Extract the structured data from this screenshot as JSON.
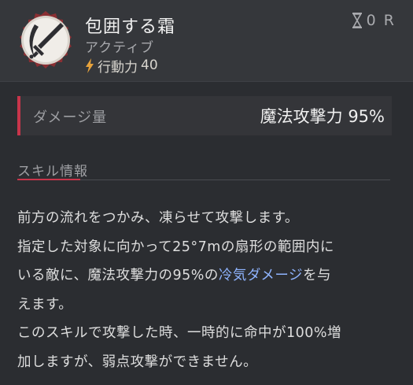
{
  "skill": {
    "name": "包囲する霜",
    "type": "アクティブ",
    "ap_label": "行動力",
    "ap_value": "40",
    "cooldown": "0 R",
    "icon": "frost-sword-icon"
  },
  "damage": {
    "label": "ダメージ量",
    "value": "魔法攻撃力 95%"
  },
  "info": {
    "title": "スキル情報",
    "lines": [
      "前方の流れをつかみ、凍らせて攻撃します。",
      "指定した対象に向かって25°7mの扇形の範囲内に",
      "いる敵に、魔法攻撃力の95%の",
      "冷気ダメージ",
      "を与",
      "えます。",
      "このスキルで攻撃した時、一時的に命中が100%増",
      "加しますが、弱点攻撃ができません。"
    ]
  },
  "colors": {
    "accent": "#c8354b",
    "highlight": "#8fb4ff",
    "ap_icon": "#e6a23c",
    "header_bg": "#35373b",
    "panel_bg": "#2b2d31"
  }
}
